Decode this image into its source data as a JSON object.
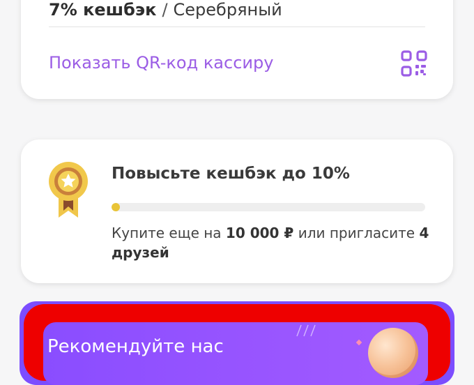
{
  "tier": {
    "cashback": "7% кешбэк",
    "separator": "/",
    "name": "Серебряный"
  },
  "qr": {
    "link_label": "Показать QR-код кассиру",
    "icon": "qr-code-icon"
  },
  "level": {
    "title": "Повысьте кешбэк до 10%",
    "progress": 0.02,
    "desc_prefix": "Купите еще на ",
    "amount": "10 000 ₽",
    "desc_middle": " или пригласите ",
    "friends": "4 друзей",
    "icon": "medal-icon"
  },
  "promo": {
    "title": "Рекомендуйте нас",
    "icon": "coin-icon"
  },
  "colors": {
    "accent_purple": "#9b5de5",
    "progress_yellow": "#e9c437",
    "promo_purple": "#7c4dff",
    "highlight_red": "#ee0000"
  }
}
